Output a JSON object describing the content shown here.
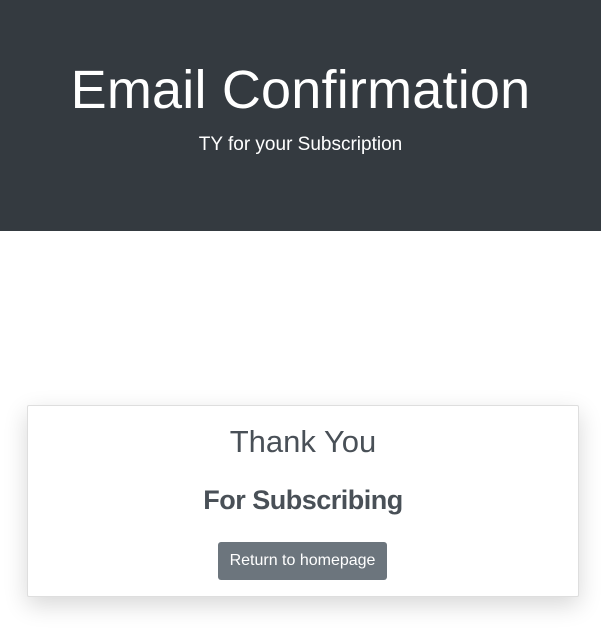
{
  "hero": {
    "title": "Email Confirmation",
    "subtitle": "TY for your Subscription"
  },
  "card": {
    "title": "Thank You",
    "subtitle": "For Subscribing",
    "button_label": "Return to homepage"
  },
  "colors": {
    "hero_background": "#343a40",
    "card_text": "#495057",
    "button_background": "#6c757d"
  }
}
